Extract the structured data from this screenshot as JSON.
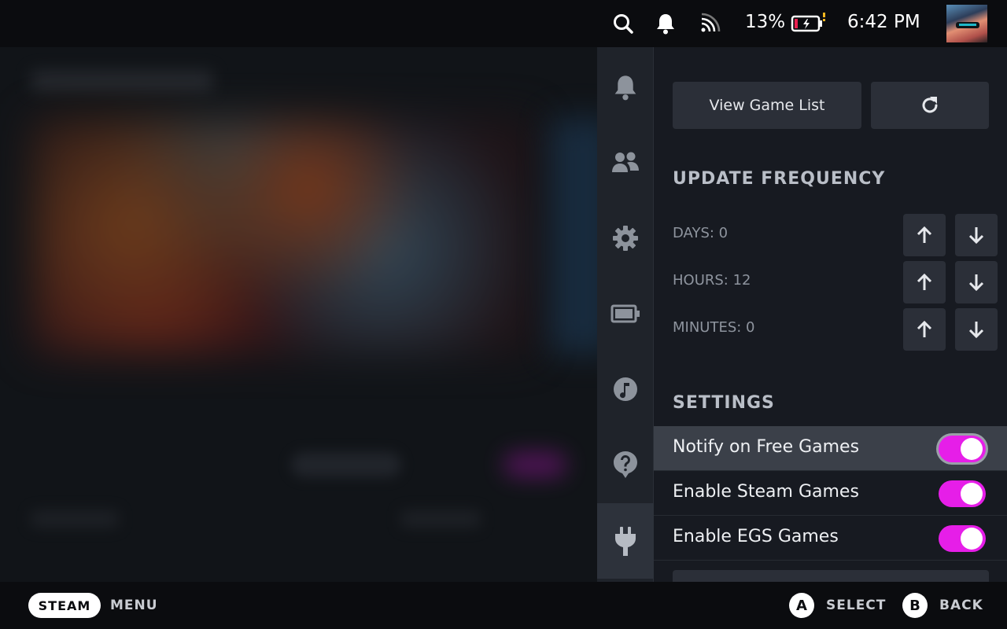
{
  "topbar": {
    "icons": [
      "search-icon",
      "bell-icon",
      "wifi-icon",
      "battery-charging-icon"
    ],
    "battery_percent": "13%",
    "time": "6:42 PM",
    "avatar_icon": "user-avatar"
  },
  "rail": {
    "items": [
      {
        "icon": "bell-icon",
        "active": false
      },
      {
        "icon": "friends-icon",
        "active": false
      },
      {
        "icon": "gear-icon",
        "active": false
      },
      {
        "icon": "battery-icon",
        "active": false
      },
      {
        "icon": "music-icon",
        "active": false
      },
      {
        "icon": "help-icon",
        "active": false
      },
      {
        "icon": "plug-icon",
        "active": true
      }
    ]
  },
  "panel": {
    "view_game_list_label": "View Game List",
    "refresh_icon": "refresh-icon",
    "update_frequency_title": "UPDATE FREQUENCY",
    "frequency": [
      {
        "label": "DAYS: 0"
      },
      {
        "label": "HOURS: 12"
      },
      {
        "label": "MINUTES: 0"
      }
    ],
    "settings_title": "SETTINGS",
    "toggles": [
      {
        "label": "Notify on Free Games",
        "on": true,
        "focused": true
      },
      {
        "label": "Enable Steam Games",
        "on": true,
        "focused": false
      },
      {
        "label": "Enable EGS Games",
        "on": true,
        "focused": false
      }
    ]
  },
  "bottombar": {
    "steam_label": "STEAM",
    "menu_label": "MENU",
    "a_button": "A",
    "select_label": "SELECT",
    "b_button": "B",
    "back_label": "BACK"
  },
  "colors": {
    "accent_toggle": "#e61ee8",
    "panel_bg": "#171a21",
    "rail_bg": "#1f232a",
    "bar_bg": "#0b0c0f"
  }
}
